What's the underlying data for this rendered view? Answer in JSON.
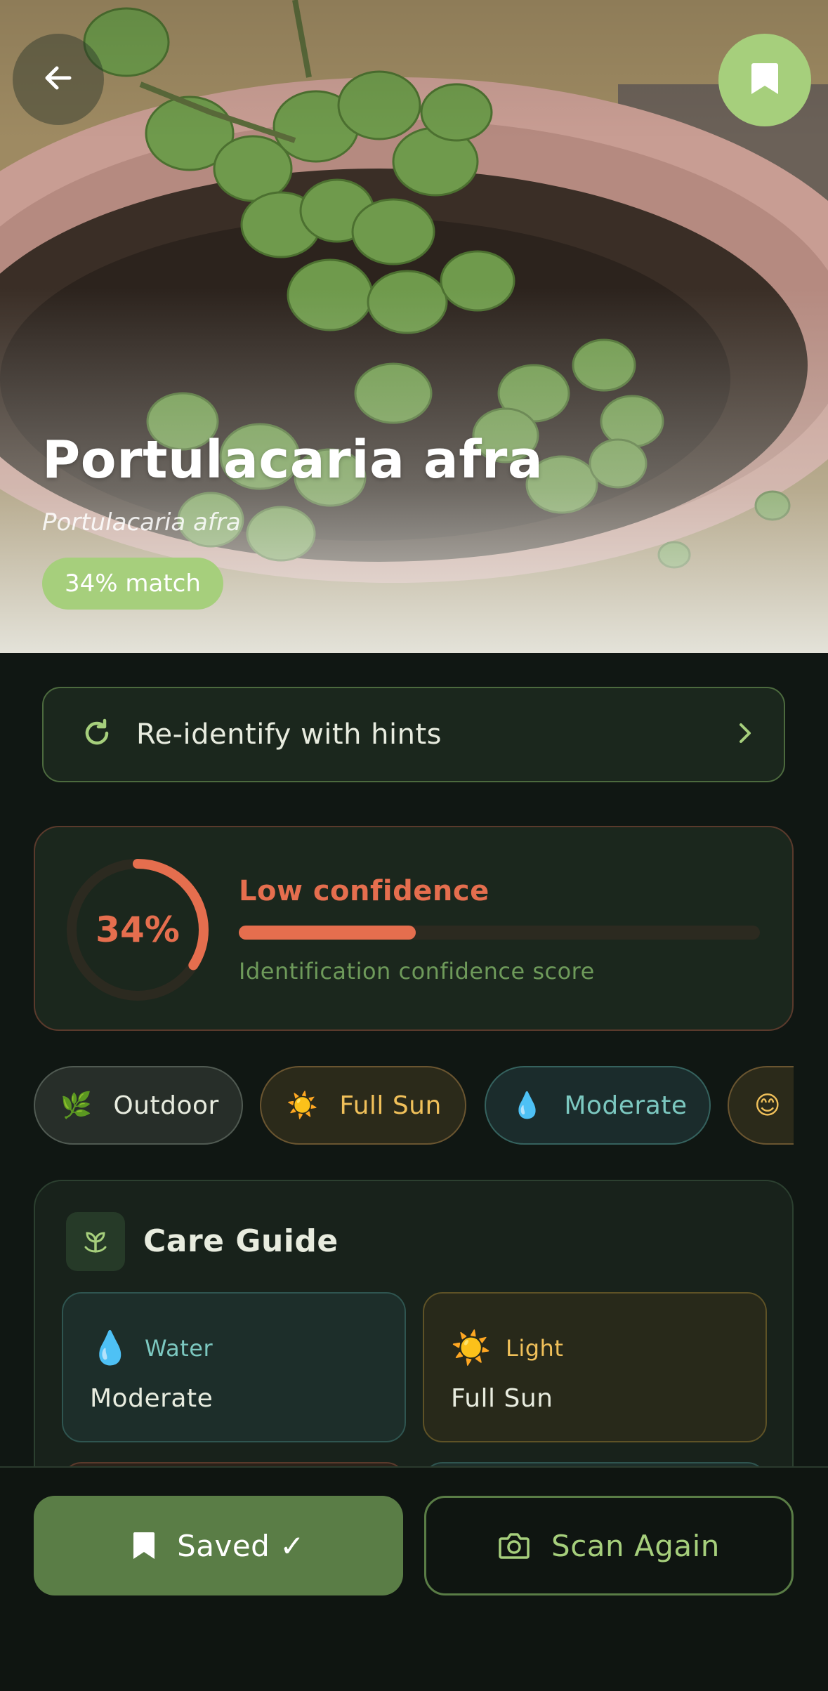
{
  "hero": {
    "common_name": "Portulacaria afra",
    "scientific_name": "Portulacaria afra",
    "match_badge": "34% match"
  },
  "icons": {
    "back": "arrow-left-icon",
    "bookmark": "bookmark-icon",
    "refresh": "refresh-icon",
    "chevron": "chevron-right-icon"
  },
  "reidentify": {
    "label": "Re-identify with hints"
  },
  "confidence": {
    "percent_label": "34%",
    "value": 0.34,
    "level": "Low confidence",
    "caption": "Identification confidence score",
    "color": "#e56e4e"
  },
  "chips": [
    {
      "icon": "🌿",
      "label": "Outdoor"
    },
    {
      "icon": "☀️",
      "label": "Full Sun"
    },
    {
      "icon": "💧",
      "label": "Moderate"
    },
    {
      "icon": "😊",
      "label": ""
    }
  ],
  "care_guide": {
    "title": "Care Guide",
    "tiles": [
      {
        "icon": "💧",
        "name": "Water",
        "value": "Moderate"
      },
      {
        "icon": "☀️",
        "name": "Light",
        "value": "Full Sun"
      }
    ]
  },
  "actions": {
    "saved_label": "Saved ✓",
    "scan_label": "Scan Again"
  },
  "colors": {
    "accent_green": "#a6cf7c",
    "button_green": "#5a7d46",
    "background": "#101713"
  }
}
